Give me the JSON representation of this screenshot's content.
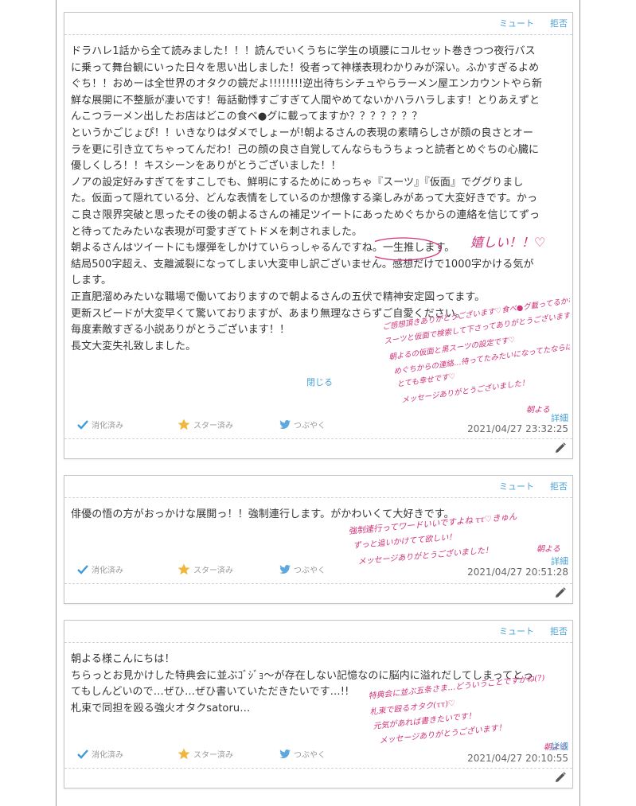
{
  "common": {
    "mute_label": "ミュート",
    "reject_label": "拒否",
    "detail_label": "詳細",
    "close_label": "閉じる",
    "digested_label": "消化済み",
    "starred_label": "スター済み",
    "tweet_label": "つぶやく",
    "colors": {
      "link": "#4aa3d8",
      "check": "#3a9bd8",
      "star": "#f0b73c",
      "ink": "#d0347a"
    },
    "icons": [
      "check-icon",
      "star-icon",
      "twitter-bird-icon",
      "pencil-icon"
    ]
  },
  "messages": [
    {
      "lines": [
        "ドラハレ1話から全て読みました！！！読んでいくうちに学生の頃腰にコルセット巻きつつ夜行バス",
        "に乗って舞台観にいった日々を思い出しました！役者って神様表現わかりみが深い。ふかすぎるよめ",
        "ぐち！！おめーは全世界のオタクの鏡だよ!!!!!!!!逆出待ちシチュやらラーメン屋エンカウントやら新",
        "鮮な展開に不整脈が凄いです！毎話動悸すごすぎて人間やめてないかハラハラします！とりあえずと",
        "んこつラーメン出したお店はどこの食べ●グに載ってますか？？？？？？？",
        "というかごじょぴ！！いきなりはダメでしょーが!朝よるさんの表現の素晴らしさが顔の良さとオー",
        "ラを更に引き立てちゃってんだわ！己の顔の良さ自覚してんならもうちょっと読者とめぐちの心臓に",
        "優しくしろ！！キスシーンをありがとうございました！！",
        "ノアの設定好みすぎてをすこしでも、鮮明にするためにめっちゃ『スーツ』『仮面』でググりまし",
        "た。仮面って隠れている分、どんな表情をしているのか想像する楽しみがあって大変好きです。かっ",
        "こ良さ限界突破と思ったその後の朝よるさんの補足ツイートにあっためぐちからの連絡を信じてずっ",
        "と待ってたみたいな表現が可愛すぎてトドメを刺されました。",
        "朝よるさんはツイートにも爆弾をしかけていらっしゃるんですね。一生推します。",
        "結局500字超え、支離滅裂になってしまい大変申し訳ございません。感想だけで1000字かける気が",
        "します。",
        "正直肥溜めみたいな職場で働いておりますので朝よるさんの五伏で精神安定図ってます。",
        "更新スピードが大変早くて驚いておりますが、あまり無理なさらずご自愛ください。",
        "毎度素敵すぎる小説ありがとうございます！！",
        "長文大変失礼致しました。"
      ],
      "timestamp": "2021/04/27 23:32:25",
      "reply": {
        "note": "嬉しい！！♡",
        "lines": [
          "ご感想頂きありがとうございます♡食べ●グ載ってるかなー!?笑",
          "スーツと仮面で検索して下さってありがとうございます！",
          "朝よるの仮面と黒スーツの設定です♡",
          "めぐちからの連絡…待ってたみたいになってたならば",
          "とても幸せです♡",
          "メッセージありがとうございました！",
          "朝よる"
        ]
      }
    },
    {
      "lines": [
        "俳優の悟の方がおっかけな展開っ！！強制連行します。がかわいくて大好きです。"
      ],
      "timestamp": "2021/04/27 20:51:28",
      "reply": {
        "lines": [
          "強制連行ってワードいいですよね ττ♡きゅん",
          "ずっと追いかけてて欲しい！",
          "メッセージありがとうございました！",
          "朝よる"
        ]
      }
    },
    {
      "lines": [
        "朝よる様こんにちは！",
        "ちらっとお見かけした特典会に並ぶｺﾞｼﾞｮ〜が存在しない記憶なのに脳内に溢れだしてしまってとっ",
        "てもしんどいので…ぜひ…ぜひ書いていただきたいです…!!",
        "札束で同担を殴る強火オタクsatoru…"
      ],
      "timestamp": "2021/04/27 20:10:55",
      "reply": {
        "lines": [
          "特典会に並ぶ五条さま…どういうことですかね(?)",
          "札束で殴るオタク(ττ)♡",
          "元気があれば書きたいです！",
          "メッセージありがとうございます！",
          "朝よる"
        ]
      }
    }
  ]
}
